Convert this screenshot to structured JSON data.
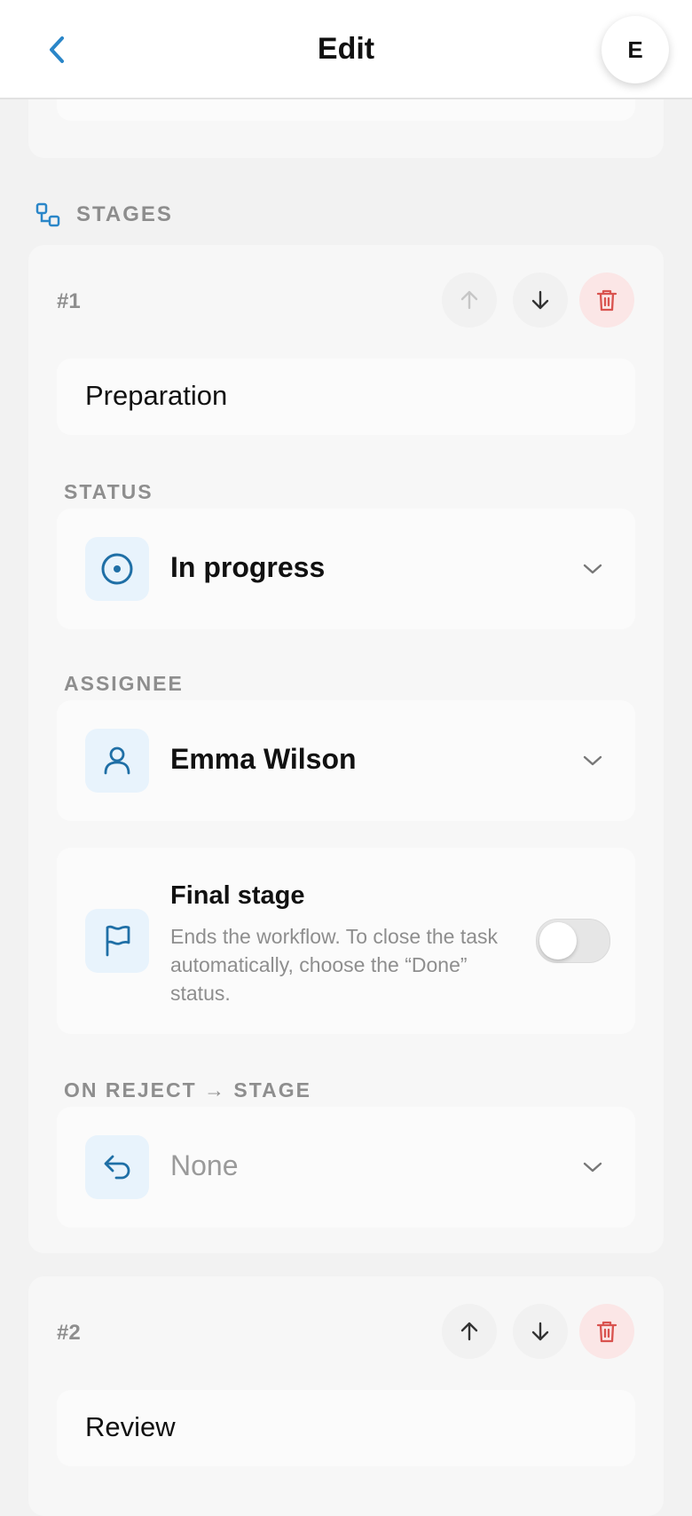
{
  "header": {
    "title": "Edit",
    "avatar_initial": "E"
  },
  "section": {
    "title": "STAGES"
  },
  "stages": [
    {
      "number": "#1",
      "name": "Preparation",
      "status_label": "STATUS",
      "status_value": "In progress",
      "assignee_label": "ASSIGNEE",
      "assignee_value": "Emma Wilson",
      "final_title": "Final stage",
      "final_desc": "Ends the workflow. To close the task automatically, choose the “Done” status.",
      "final_enabled": false,
      "reject_label": "ON REJECT → STAGE",
      "reject_value": "None"
    },
    {
      "number": "#2",
      "name": "Review"
    }
  ],
  "colors": {
    "accent": "#2a86c8",
    "icon_bg": "#e8f3fc",
    "delete_bg": "#fbe6e6",
    "delete_icon": "#d9534f"
  }
}
